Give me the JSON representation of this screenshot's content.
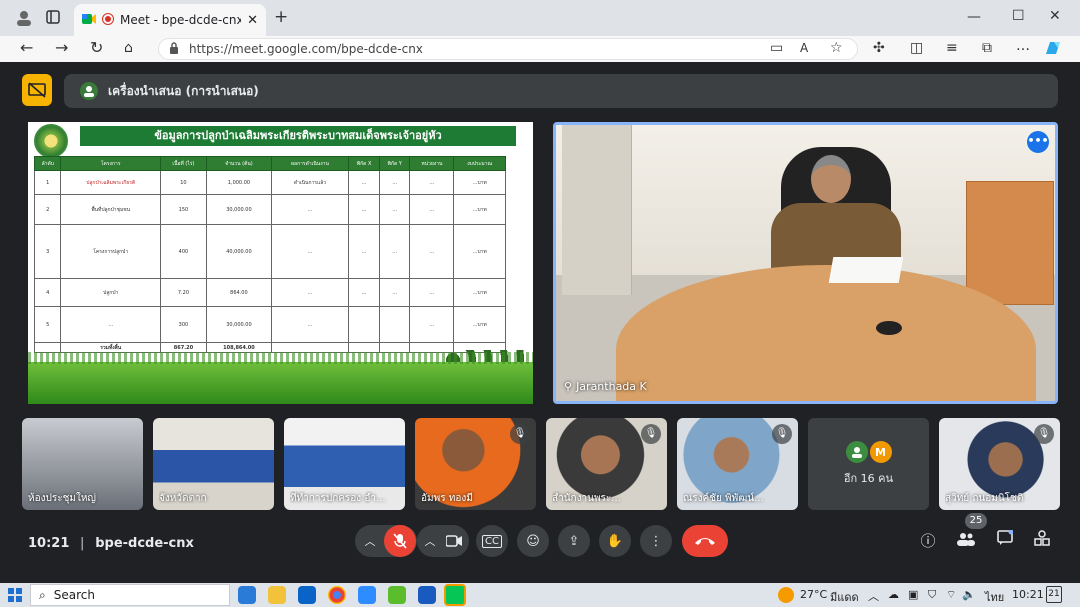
{
  "browser": {
    "tab_title": "Meet - bpe-dcde-cnx",
    "url": "https://meet.google.com/bpe-dcde-cnx"
  },
  "presentation": {
    "label": "เครื่องนำเสนอ (การนำเสนอ)"
  },
  "slide": {
    "title": "ข้อมูลการปลูกป่าเฉลิมพระเกียรติพระบาทสมเด็จพระเจ้าอยู่หัว",
    "headers": [
      "ลำดับ",
      "โครงการ",
      "เนื้อที่ (ไร่)",
      "จำนวน (ต้น)",
      "ผลการดำเนินงาน",
      "พิกัด X",
      "พิกัด Y",
      "หน่วยงาน",
      "งบประมาณ"
    ],
    "rows": [
      [
        "1",
        "ปลูกป่าเฉลิมพระเกียรติ",
        "10",
        "1,000.00",
        "ดำเนินการแล้ว",
        "...",
        "...",
        "...",
        "...บาท"
      ],
      [
        "2",
        "พื้นที่ปลูกป่าชุมชน",
        "150",
        "30,000.00",
        "...",
        "...",
        "...",
        "...",
        "...บาท"
      ],
      [
        "3",
        "โครงการปลูกป่า",
        "400",
        "40,000.00",
        "...",
        "...",
        "...",
        "...",
        "...บาท"
      ],
      [
        "4",
        "ปลูกป่า",
        "7.20",
        "864.00",
        "...",
        "...",
        "...",
        "...",
        "...บาท"
      ],
      [
        "5",
        "...",
        "300",
        "30,000.00",
        "...",
        "",
        "",
        "...",
        "...บาท"
      ]
    ],
    "total_label": "รวมทั้งสิ้น",
    "total_area": "867.20",
    "total_trees": "108,864.00"
  },
  "speaker": {
    "name": "Jaranthada K"
  },
  "participants": [
    {
      "name": "ห้องประชุมใหญ่",
      "muted": false
    },
    {
      "name": "จังหวัดตาก",
      "muted": false
    },
    {
      "name": "ที่ทำการปกครอง อำ...",
      "muted": false
    },
    {
      "name": "อัมพร ทองมี",
      "muted": true
    },
    {
      "name": "สำนักงานพระ...",
      "muted": true
    },
    {
      "name": "ณรงค์ชัย พิพัฒน์...",
      "muted": true
    },
    {
      "name": "สุวิทย์ ถนอมนิโชติ",
      "muted": true
    }
  ],
  "more_tile": {
    "label": "อีก 16 คน",
    "avatar_letter": "M"
  },
  "controls": {
    "time": "10:21",
    "meeting_code": "bpe-dcde-cnx",
    "participant_count": "25"
  },
  "taskbar": {
    "search_placeholder": "Search",
    "weather": "27°C",
    "weather_desc": "มีแดด",
    "lang": "ไทย",
    "clock": "10:21",
    "notifications": "21"
  },
  "colors": {
    "meet_bg": "#202124",
    "panel": "#3c4043",
    "accent_blue": "#8ab4f8",
    "end_call_red": "#ea4335",
    "present_yellow": "#f6b400"
  }
}
